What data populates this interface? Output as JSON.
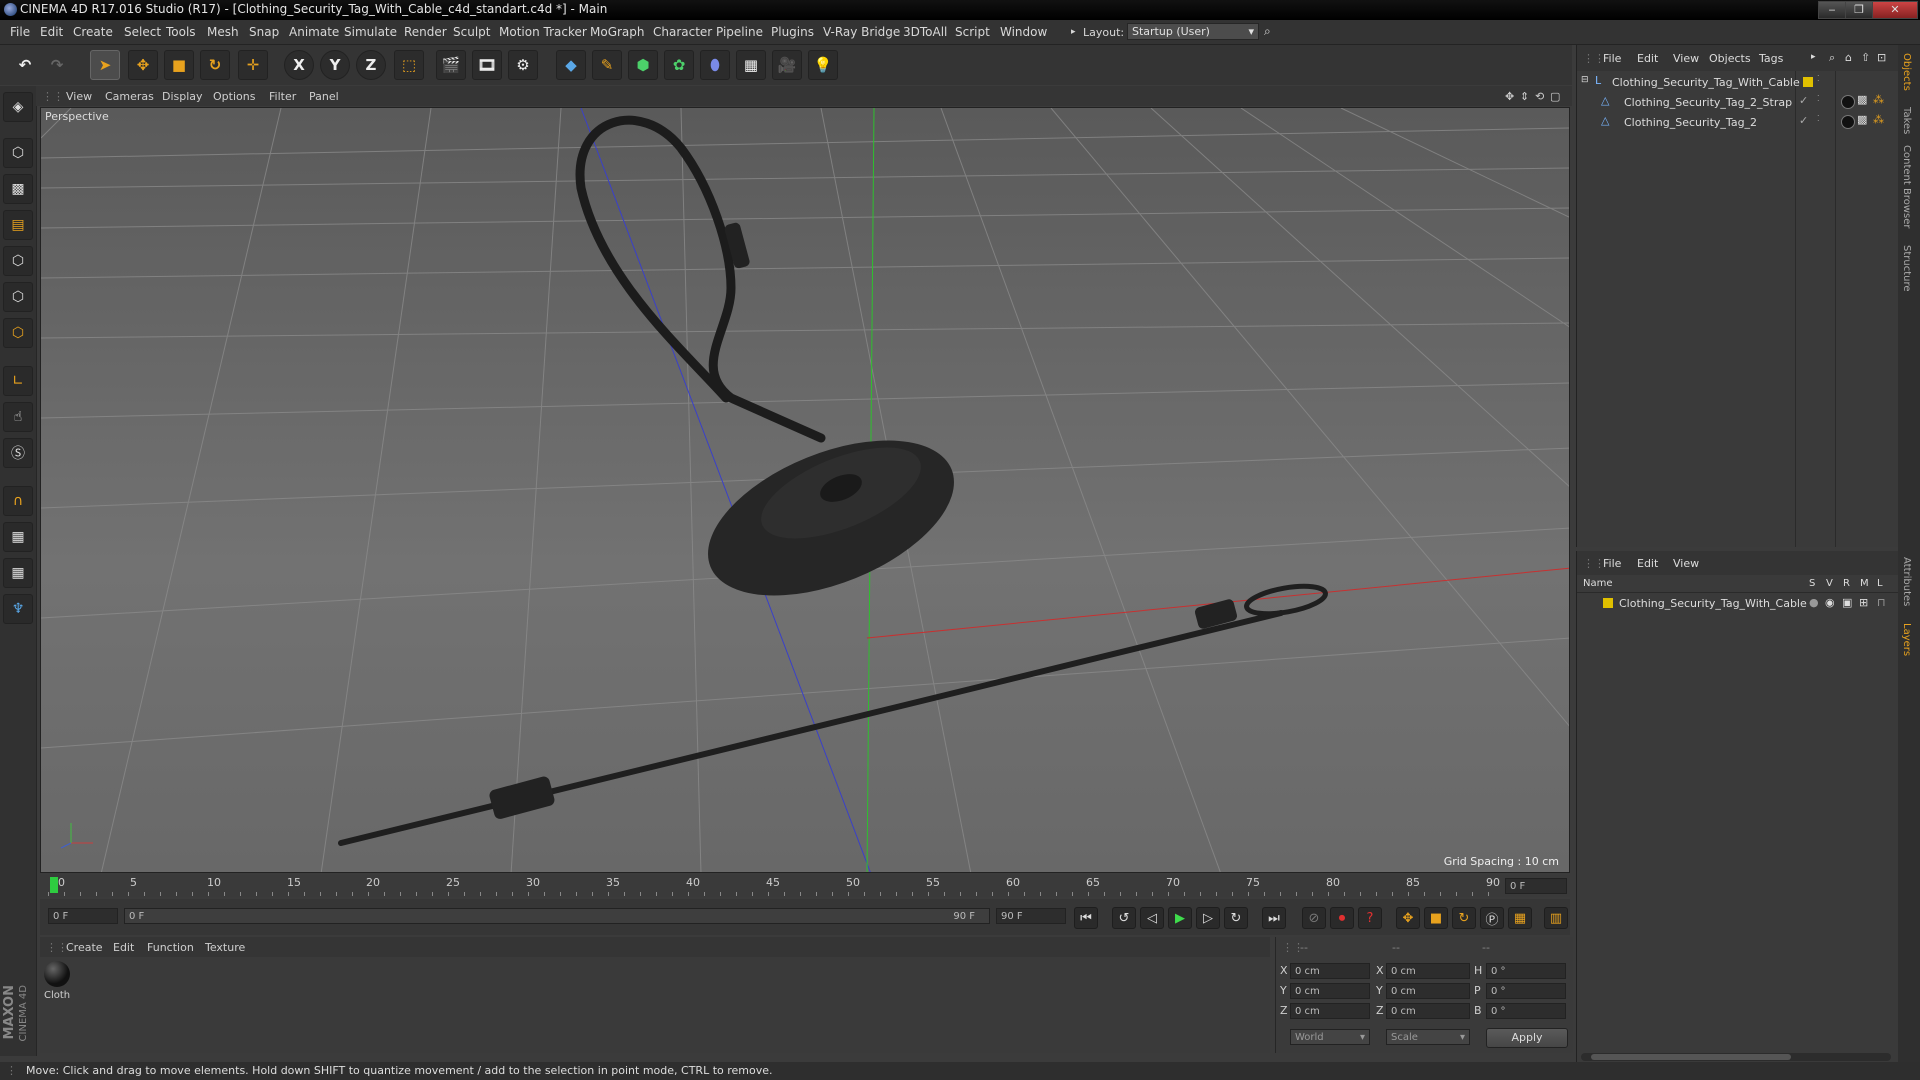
{
  "window": {
    "title": "CINEMA 4D R17.016 Studio (R17) - [Clothing_Security_Tag_With_Cable_c4d_standart.c4d *] - Main",
    "min": "‒",
    "max": "❐",
    "close": "✕"
  },
  "menu": {
    "items": [
      "File",
      "Edit",
      "Create",
      "Select",
      "Tools",
      "Mesh",
      "Snap",
      "Animate",
      "Simulate",
      "Render",
      "Sculpt",
      "Motion Tracker",
      "MoGraph",
      "Character",
      "Pipeline",
      "Plugins",
      "V-Ray Bridge",
      "3DToAll",
      "Script",
      "Window"
    ],
    "layout_label": "Layout:",
    "layout_value": "Startup (User)"
  },
  "toolbar": {
    "x_label": "X",
    "y_label": "Y",
    "z_label": "Z"
  },
  "viewport": {
    "menu": [
      "View",
      "Cameras",
      "Display",
      "Options",
      "Filter",
      "Panel"
    ],
    "title": "Perspective",
    "grid_spacing": "Grid Spacing : 10 cm"
  },
  "timeline": {
    "ticks": [
      "0",
      "5",
      "10",
      "15",
      "20",
      "25",
      "30",
      "35",
      "40",
      "45",
      "50",
      "55",
      "60",
      "65",
      "70",
      "75",
      "80",
      "85",
      "90"
    ],
    "current_frame": "0 F",
    "start_field": "0 F",
    "range_start": "0 F",
    "range_end": "90 F",
    "end_field": "90 F"
  },
  "materials": {
    "menu": [
      "Create",
      "Edit",
      "Function",
      "Texture"
    ],
    "items": [
      {
        "label": "Cloth"
      }
    ]
  },
  "coords": {
    "header": [
      "--",
      "--",
      "--"
    ],
    "rows": [
      {
        "a": "X",
        "av": "0 cm",
        "b": "X",
        "bv": "0 cm",
        "c": "H",
        "cv": "0 °"
      },
      {
        "a": "Y",
        "av": "0 cm",
        "b": "Y",
        "bv": "0 cm",
        "c": "P",
        "cv": "0 °"
      },
      {
        "a": "Z",
        "av": "0 cm",
        "b": "Z",
        "bv": "0 cm",
        "c": "B",
        "cv": "0 °"
      }
    ],
    "mode1": "World",
    "mode2": "Scale",
    "apply": "Apply"
  },
  "object_manager": {
    "menu": [
      "File",
      "Edit",
      "View",
      "Objects",
      "Tags"
    ],
    "objects": [
      {
        "name": "Clothing_Security_Tag_With_Cable"
      },
      {
        "name": "Clothing_Security_Tag_2_Strap"
      },
      {
        "name": "Clothing_Security_Tag_2"
      }
    ]
  },
  "layer_manager": {
    "menu": [
      "File",
      "Edit",
      "View"
    ],
    "col_name": "Name",
    "cols": [
      "S",
      "V",
      "R",
      "M",
      "L"
    ],
    "layers": [
      {
        "name": "Clothing_Security_Tag_With_Cable",
        "color": "#e0c000"
      }
    ]
  },
  "right_tabs": [
    "Objects",
    "Takes",
    "Content Browser",
    "Structure",
    "Attributes",
    "Layers"
  ],
  "status": "Move: Click and drag to move elements. Hold down SHIFT to quantize movement / add to the selection in point mode, CTRL to remove.",
  "brand": {
    "maxon": "MAXON",
    "c4d": "CINEMA 4D"
  },
  "colors": {
    "accent": "#e8a21e",
    "selection": "#3a5f8a",
    "x_axis": "#c03030",
    "y_axis": "#30b030",
    "z_axis": "#3040c0"
  }
}
